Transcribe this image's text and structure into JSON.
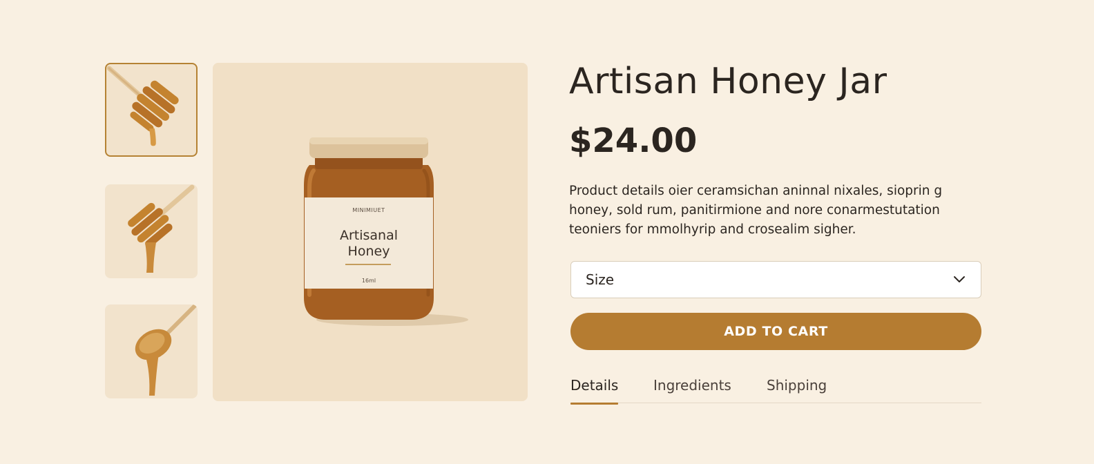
{
  "product": {
    "title": "Artisan Honey Jar",
    "price": "$24.00",
    "description": "Product details oier ceramsichan aninnal nixales, sioprin g honey, sold rum, panitirmione and nore conarmestutation teoniers for mmolhyrip and crosealim sigher.",
    "jar_label": {
      "brand": "MINIMIUET",
      "name_line1": "Artisanal",
      "name_line2": "Honey",
      "volume": "16ml"
    }
  },
  "gallery": {
    "thumbnails": [
      {
        "icon": "honey-dipper-icon",
        "active": true
      },
      {
        "icon": "honey-dipper-drip-icon",
        "active": false
      },
      {
        "icon": "honey-spoon-icon",
        "active": false
      }
    ]
  },
  "size_select": {
    "label": "Size",
    "icon": "chevron-down-icon"
  },
  "cart_button": {
    "label": "ADD TO CART"
  },
  "tabs": [
    {
      "label": "Details",
      "active": true
    },
    {
      "label": "Ingredients",
      "active": false
    },
    {
      "label": "Shipping",
      "active": false
    }
  ],
  "colors": {
    "background": "#f9f0e2",
    "accent": "#b57c31",
    "text": "#2b2520",
    "tile": "#f2e3cc",
    "honey": "#a55f22"
  }
}
